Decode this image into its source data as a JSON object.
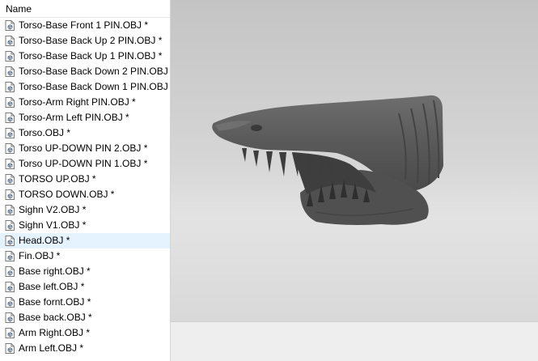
{
  "panel": {
    "header": "Name",
    "files": [
      {
        "name": "Torso-Base Front 1 PIN.OBJ *",
        "icon": "obj-file-icon",
        "selected": false
      },
      {
        "name": "Torso-Base Back Up 2 PIN.OBJ *",
        "icon": "obj-file-icon",
        "selected": false
      },
      {
        "name": "Torso-Base Back Up 1 PIN.OBJ *",
        "icon": "obj-file-icon",
        "selected": false
      },
      {
        "name": "Torso-Base Back Down 2 PIN.OBJ *",
        "icon": "obj-file-icon",
        "selected": false
      },
      {
        "name": "Torso-Base Back Down 1 PIN.OBJ *",
        "icon": "obj-file-icon",
        "selected": false
      },
      {
        "name": "Torso-Arm Right PIN.OBJ *",
        "icon": "obj-file-icon",
        "selected": false
      },
      {
        "name": "Torso-Arm Left PIN.OBJ *",
        "icon": "obj-file-icon",
        "selected": false
      },
      {
        "name": "Torso.OBJ *",
        "icon": "obj-file-icon",
        "selected": false
      },
      {
        "name": "Torso UP-DOWN PIN 2.OBJ *",
        "icon": "obj-file-icon",
        "selected": false
      },
      {
        "name": "Torso UP-DOWN PIN 1.OBJ *",
        "icon": "obj-file-icon",
        "selected": false
      },
      {
        "name": "TORSO UP.OBJ *",
        "icon": "obj-file-icon",
        "selected": false
      },
      {
        "name": "TORSO DOWN.OBJ *",
        "icon": "obj-file-icon",
        "selected": false
      },
      {
        "name": "Sighn V2.OBJ *",
        "icon": "obj-file-icon",
        "selected": false
      },
      {
        "name": "Sighn V1.OBJ *",
        "icon": "obj-file-icon",
        "selected": false
      },
      {
        "name": "Head.OBJ *",
        "icon": "obj-file-icon",
        "selected": true
      },
      {
        "name": "Fin.OBJ *",
        "icon": "obj-file-icon",
        "selected": false
      },
      {
        "name": "Base right.OBJ *",
        "icon": "obj-file-icon",
        "selected": false
      },
      {
        "name": "Base left.OBJ *",
        "icon": "obj-file-icon",
        "selected": false
      },
      {
        "name": "Base fornt.OBJ *",
        "icon": "obj-file-icon",
        "selected": false
      },
      {
        "name": "Base back.OBJ *",
        "icon": "obj-file-icon",
        "selected": false
      },
      {
        "name": "Arm Right.OBJ *",
        "icon": "obj-file-icon",
        "selected": false
      },
      {
        "name": "Arm Left.OBJ *",
        "icon": "obj-file-icon",
        "selected": false
      }
    ]
  },
  "viewport": {
    "model": "shark-head-model",
    "colors": {
      "model": "#5c5c5c",
      "selection": "#e5f3ff"
    }
  }
}
